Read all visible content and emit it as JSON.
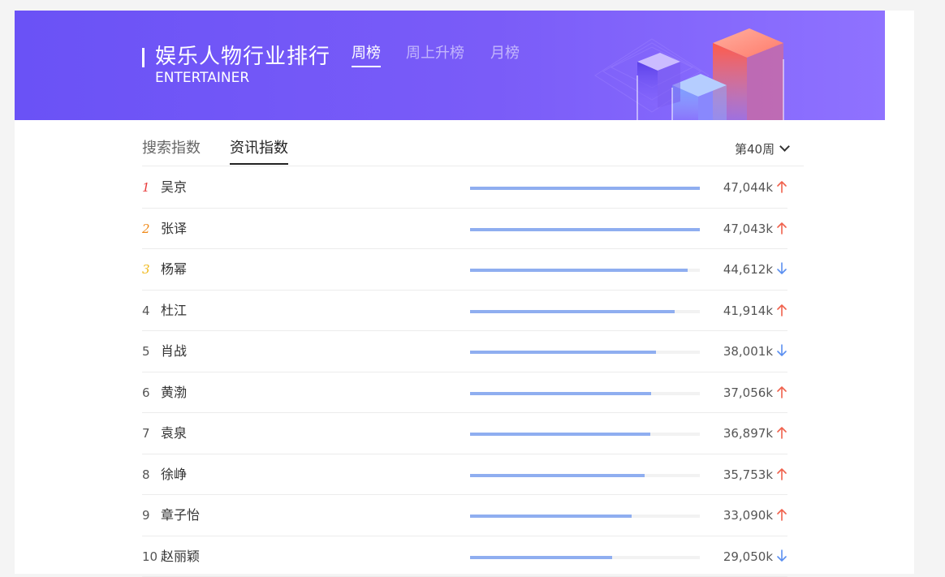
{
  "banner": {
    "title": "娱乐人物行业排行",
    "subtitle": "ENTERTAINER",
    "tabs": [
      {
        "label": "周榜",
        "active": true
      },
      {
        "label": "周上升榜",
        "active": false
      },
      {
        "label": "月榜",
        "active": false
      }
    ]
  },
  "subtabs": [
    {
      "label": "搜索指数",
      "active": false
    },
    {
      "label": "资讯指数",
      "active": true
    }
  ],
  "week_selector": {
    "label": "第40周",
    "icon": "chevron-down-icon"
  },
  "colors": {
    "up": "#f0624d",
    "down": "#5b8ff0",
    "bar": "#8faef0"
  },
  "ranking": [
    {
      "rank": "1",
      "name": "吴京",
      "value": "47,044k",
      "trend": "up",
      "ratio": 1.0
    },
    {
      "rank": "2",
      "name": "张译",
      "value": "47,043k",
      "trend": "up",
      "ratio": 1.0
    },
    {
      "rank": "3",
      "name": "杨幂",
      "value": "44,612k",
      "trend": "down",
      "ratio": 0.948
    },
    {
      "rank": "4",
      "name": "杜江",
      "value": "41,914k",
      "trend": "up",
      "ratio": 0.891
    },
    {
      "rank": "5",
      "name": "肖战",
      "value": "38,001k",
      "trend": "down",
      "ratio": 0.808
    },
    {
      "rank": "6",
      "name": "黄渤",
      "value": "37,056k",
      "trend": "up",
      "ratio": 0.788
    },
    {
      "rank": "7",
      "name": "袁泉",
      "value": "36,897k",
      "trend": "up",
      "ratio": 0.784
    },
    {
      "rank": "8",
      "name": "徐峥",
      "value": "35,753k",
      "trend": "up",
      "ratio": 0.76
    },
    {
      "rank": "9",
      "name": "章子怡",
      "value": "33,090k",
      "trend": "up",
      "ratio": 0.703
    },
    {
      "rank": "10",
      "name": "赵丽颖",
      "value": "29,050k",
      "trend": "down",
      "ratio": 0.618
    }
  ]
}
